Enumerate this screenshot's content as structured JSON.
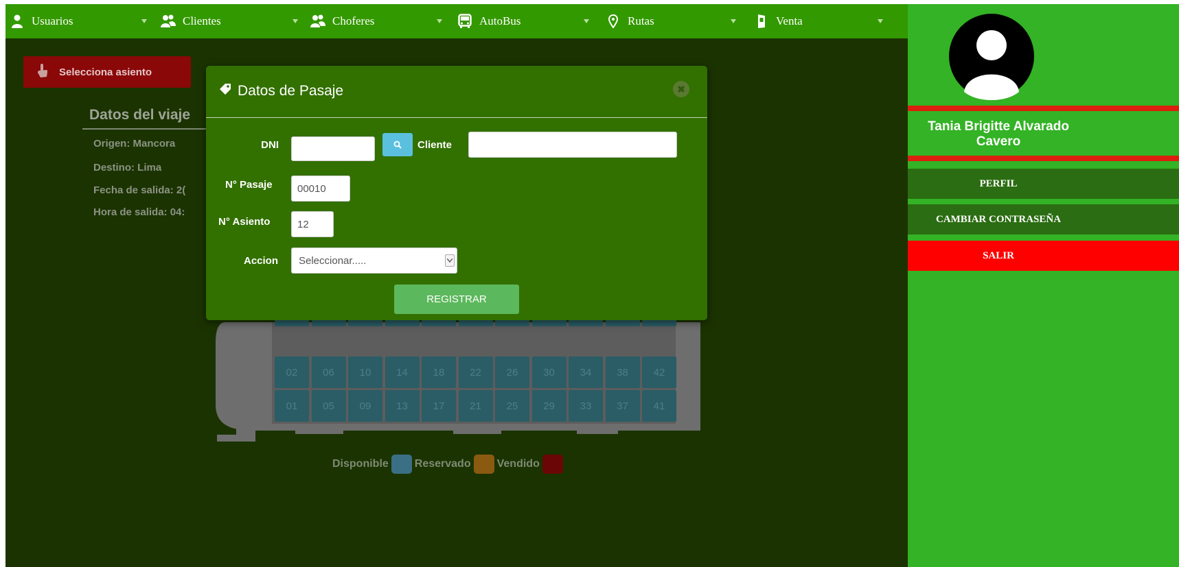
{
  "nav": {
    "items": [
      {
        "label": "Usuarios",
        "icon": "user-icon"
      },
      {
        "label": "Clientes",
        "icon": "users-icon"
      },
      {
        "label": "Choferes",
        "icon": "users-icon"
      },
      {
        "label": "AutoBus",
        "icon": "bus-icon"
      },
      {
        "label": "Rutas",
        "icon": "map-marker-icon"
      },
      {
        "label": "Venta",
        "icon": "phone-icon"
      }
    ]
  },
  "main": {
    "select_seat_label": "Selecciona asiento",
    "trip": {
      "title": "Datos del viaje",
      "origin": "Origen:  Mancora",
      "destination": "Destino:  Lima",
      "departure_date": "Fecha de salida:  2(",
      "departure_time": "Hora de salida:  04:"
    },
    "seats_top_row": [
      "02",
      "06",
      "10",
      "14",
      "18",
      "22",
      "26",
      "30",
      "34",
      "38",
      "42"
    ],
    "seats_bottom_row": [
      "01",
      "05",
      "09",
      "13",
      "17",
      "21",
      "25",
      "29",
      "33",
      "37",
      "41"
    ],
    "legend": [
      {
        "label": "Disponible",
        "color": "#3a6f85"
      },
      {
        "label": "Reservado",
        "color": "#8a5a10"
      },
      {
        "label": "Vendido",
        "color": "#6b0606"
      }
    ]
  },
  "modal": {
    "title": "Datos de Pasaje",
    "dni_label": "DNI",
    "dni_value": "",
    "client_label": "Cliente",
    "client_value": "",
    "ticket_label": "N° Pasaje",
    "ticket_value": "00010",
    "seat_label": "N° Asiento",
    "seat_value": "12",
    "action_label": "Accion",
    "action_selected": "Seleccionar.....",
    "submit_label": "REGISTRAR"
  },
  "user": {
    "name_line1": "Tania Brigitte Alvarado",
    "name_line2": "Cavero",
    "profile_label": "PERFIL",
    "change_password_label": "CAMBIAR CONTRASEÑA",
    "logout_label": "SALIR"
  },
  "colors": {
    "nav_green": "#339900",
    "main_bg": "#1b3300",
    "side_green": "#33b325",
    "danger_red": "#ff0000",
    "modal_green": "#327000"
  }
}
